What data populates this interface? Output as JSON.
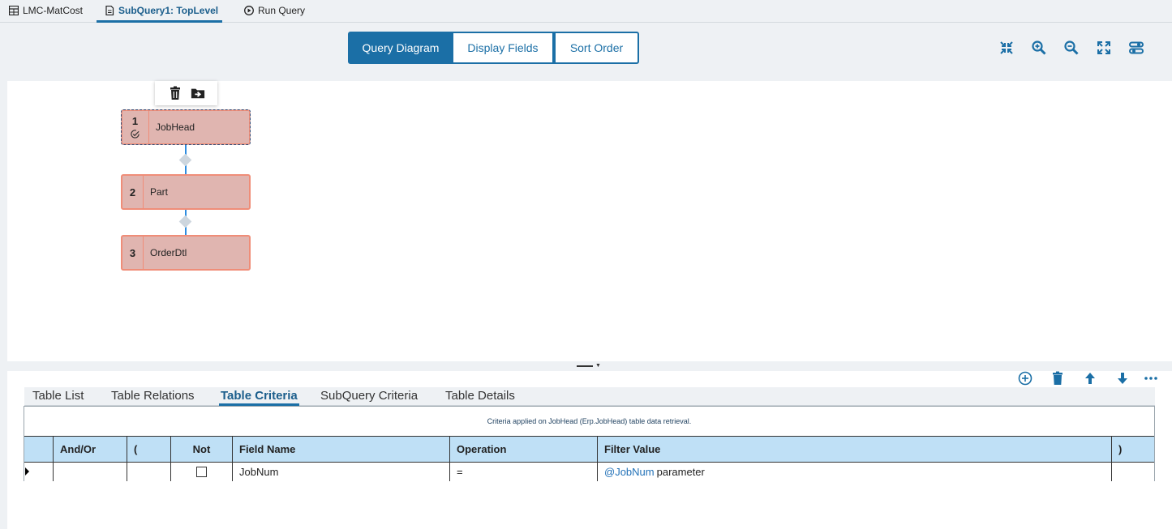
{
  "top_tabs": [
    {
      "label": "LMC-MatCost",
      "icon": "table-icon"
    },
    {
      "label": "SubQuery1: TopLevel",
      "icon": "document-icon",
      "active": true
    },
    {
      "label": "Run Query",
      "icon": "play-circle-icon"
    }
  ],
  "view_switch": {
    "diagram": "Query Diagram",
    "fields": "Display Fields",
    "sort": "Sort Order",
    "active": "Query Diagram"
  },
  "view_tools": [
    "collapse-icon",
    "zoom-in-icon",
    "zoom-out-icon",
    "fit-screen-icon",
    "settings-toggle-icon"
  ],
  "diagram": {
    "node_toolbar": [
      "delete-icon",
      "move-to-folder-icon"
    ],
    "nodes": [
      {
        "num": "1",
        "name": "JobHead",
        "selected": true
      },
      {
        "num": "2",
        "name": "Part"
      },
      {
        "num": "3",
        "name": "OrderDtl"
      }
    ]
  },
  "lower_actions": [
    "add-icon",
    "delete-icon",
    "move-up-icon",
    "move-down-icon",
    "more-icon"
  ],
  "sub_tabs": [
    {
      "label": "Table List"
    },
    {
      "label": "Table Relations"
    },
    {
      "label": "Table Criteria",
      "active": true
    },
    {
      "label": "SubQuery Criteria"
    },
    {
      "label": "Table Details"
    }
  ],
  "criteria": {
    "caption": "Criteria applied on JobHead (Erp.JobHead) table data retrieval.",
    "columns": [
      "And/Or",
      "(",
      "Not",
      "Field Name",
      "Operation",
      "Filter Value",
      ")"
    ],
    "rows": [
      {
        "and_or": "",
        "open_paren": "",
        "not": false,
        "field": "JobNum",
        "operation": "=",
        "filter_param": "@JobNum",
        "filter_text": "parameter",
        "close_paren": ""
      }
    ]
  },
  "colors": {
    "accent": "#1b6fa6",
    "node_fill": "#e0b5b0",
    "node_border": "#ef8d78",
    "grid_header": "#bfe0f6",
    "connector": "#2e8de0"
  }
}
